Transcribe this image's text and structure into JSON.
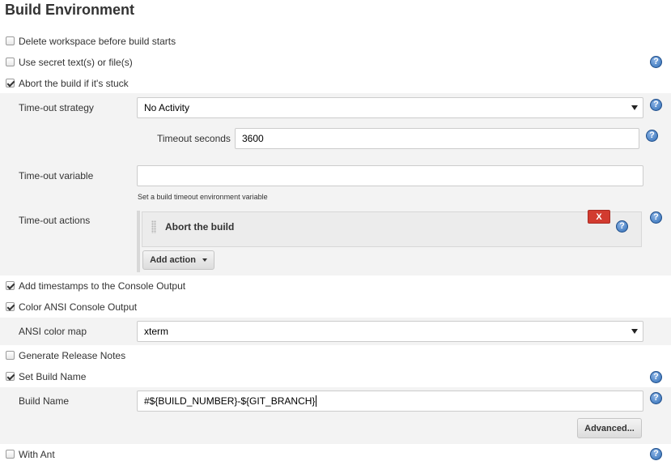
{
  "section": {
    "title": "Build Environment"
  },
  "options": {
    "delete_workspace": {
      "label": "Delete workspace before build starts",
      "checked": false
    },
    "use_secret": {
      "label": "Use secret text(s) or file(s)",
      "checked": false
    },
    "abort_stuck": {
      "label": "Abort the build if it's stuck",
      "checked": true
    },
    "add_timestamps": {
      "label": "Add timestamps to the Console Output",
      "checked": true
    },
    "color_ansi": {
      "label": "Color ANSI Console Output",
      "checked": true
    },
    "release_notes": {
      "label": "Generate Release Notes",
      "checked": false
    },
    "set_build_name": {
      "label": "Set Build Name",
      "checked": true
    },
    "with_ant": {
      "label": "With Ant",
      "checked": false
    }
  },
  "timeout": {
    "strategy_label": "Time-out strategy",
    "strategy_value": "No Activity",
    "seconds_label": "Timeout seconds",
    "seconds_value": "3600",
    "variable_label": "Time-out variable",
    "variable_value": "",
    "variable_hint": "Set a build timeout environment variable",
    "actions_label": "Time-out actions",
    "action_item": "Abort the build",
    "remove_label": "X",
    "add_action_label": "Add action"
  },
  "ansi": {
    "map_label": "ANSI color map",
    "map_value": "xterm"
  },
  "build_name": {
    "label": "Build Name",
    "value": "#${BUILD_NUMBER}-${GIT_BRANCH}",
    "advanced_label": "Advanced..."
  },
  "help_glyph": "?",
  "icons": [
    "checkbox-icon",
    "help-icon",
    "drag-handle-icon",
    "dropdown-arrow-icon"
  ],
  "colors": {
    "band": "#f3f3f3",
    "help": "#2f6db5",
    "remove_button": "#d23b2f"
  }
}
